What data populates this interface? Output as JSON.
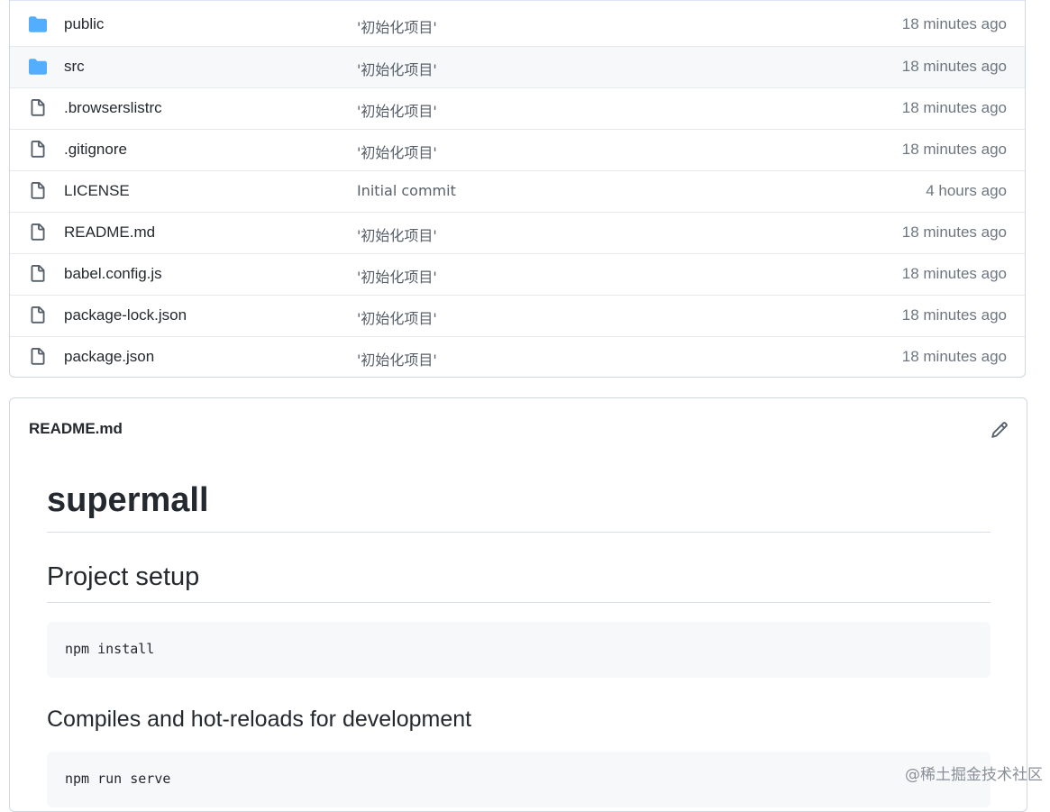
{
  "files": [
    {
      "name": "public",
      "type": "folder",
      "message": "'初始化项目'",
      "age": "18 minutes ago"
    },
    {
      "name": "src",
      "type": "folder",
      "message": "'初始化项目'",
      "age": "18 minutes ago"
    },
    {
      "name": ".browserslistrc",
      "type": "file",
      "message": "'初始化项目'",
      "age": "18 minutes ago"
    },
    {
      "name": ".gitignore",
      "type": "file",
      "message": "'初始化项目'",
      "age": "18 minutes ago"
    },
    {
      "name": "LICENSE",
      "type": "file",
      "message": "Initial commit",
      "age": "4 hours ago"
    },
    {
      "name": "README.md",
      "type": "file",
      "message": "'初始化项目'",
      "age": "18 minutes ago"
    },
    {
      "name": "babel.config.js",
      "type": "file",
      "message": "'初始化项目'",
      "age": "18 minutes ago"
    },
    {
      "name": "package-lock.json",
      "type": "file",
      "message": "'初始化项目'",
      "age": "18 minutes ago"
    },
    {
      "name": "package.json",
      "type": "file",
      "message": "'初始化项目'",
      "age": "18 minutes ago"
    }
  ],
  "readme": {
    "filename": "README.md",
    "h1": "supermall",
    "h2": "Project setup",
    "code1": "npm install",
    "h3": "Compiles and hot-reloads for development",
    "code2": "npm run serve"
  },
  "watermark": "@稀土掘金技术社区",
  "colors": {
    "folder": "#54aeff",
    "file_icon": "#57606a",
    "border": "#d0d7de"
  }
}
